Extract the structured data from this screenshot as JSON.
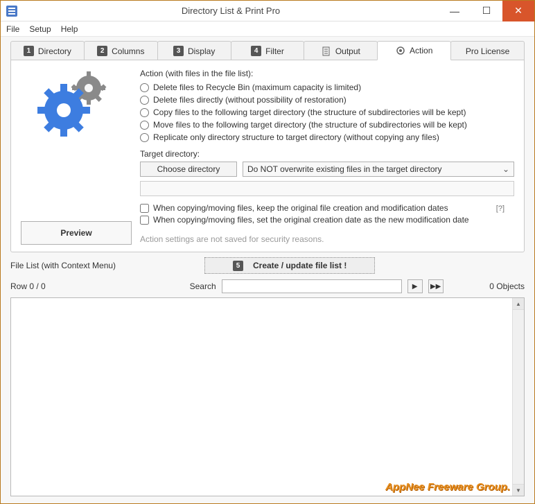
{
  "window": {
    "title": "Directory List & Print Pro"
  },
  "menu": {
    "file": "File",
    "setup": "Setup",
    "help": "Help"
  },
  "tabs": {
    "directory": "Directory",
    "columns": "Columns",
    "display": "Display",
    "filter": "Filter",
    "output": "Output",
    "action": "Action",
    "prolicense": "Pro License",
    "n1": "1",
    "n2": "2",
    "n3": "3",
    "n4": "4",
    "n5": "5"
  },
  "action": {
    "header": "Action (with files in the file list):",
    "opt1": "Delete files to Recycle Bin (maximum capacity is limited)",
    "opt2": "Delete files directly (without possibility of restoration)",
    "opt3": "Copy files to the following target directory (the structure of subdirectories will be kept)",
    "opt4": "Move files to the following target directory (the structure of subdirectories will be kept)",
    "opt5": "Replicate only directory structure to target directory (without copying any files)",
    "target_label": "Target directory:",
    "choose": "Choose directory",
    "overwrite": "Do NOT overwrite existing files in the target directory",
    "chk1": "When copying/moving files, keep the original file creation and modification dates",
    "chk2": "When copying/moving files, set the original creation date as the new modification date",
    "help": "[?]",
    "note": "Action settings are not saved for security reasons.",
    "preview": "Preview"
  },
  "filelist": {
    "label": "File List (with Context Menu)",
    "create": "Create / update file list !",
    "row": "Row 0 / 0",
    "search": "Search",
    "objects": "0 Objects"
  },
  "watermark": "AppNee Freeware Group."
}
